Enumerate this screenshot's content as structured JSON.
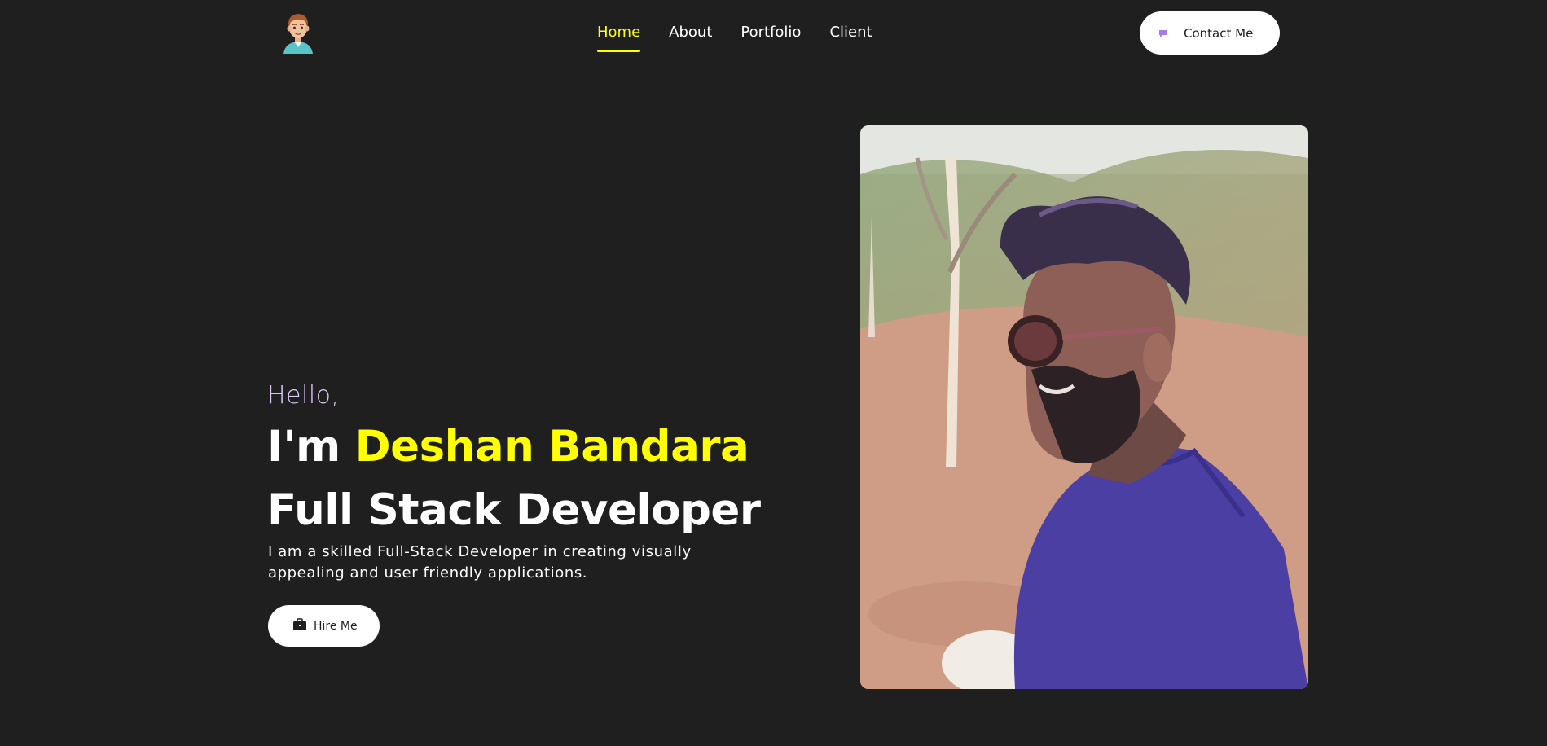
{
  "header": {
    "logo_icon": "avatar-boy-icon",
    "nav": [
      {
        "label": "Home",
        "active": true
      },
      {
        "label": "About",
        "active": false
      },
      {
        "label": "Portfolio",
        "active": false
      },
      {
        "label": "Client",
        "active": false
      }
    ],
    "contact_button": {
      "label": "Contact Me",
      "icon": "chat-bubble-icon"
    }
  },
  "hero": {
    "greeting": "Hello,",
    "intro_prefix": "I'm ",
    "name": "Deshan Bandara",
    "role": "Full Stack Developer",
    "description": "I am a skilled Full-Stack Developer in creating visually appealing and user friendly applications.",
    "hire_button": {
      "label": "Hire Me",
      "icon": "briefcase-icon"
    },
    "photo": "profile-photo"
  },
  "colors": {
    "background": "#1f1f1f",
    "accent": "#ffff00",
    "text": "#ffffff",
    "greeting": "#d9c8f5"
  }
}
